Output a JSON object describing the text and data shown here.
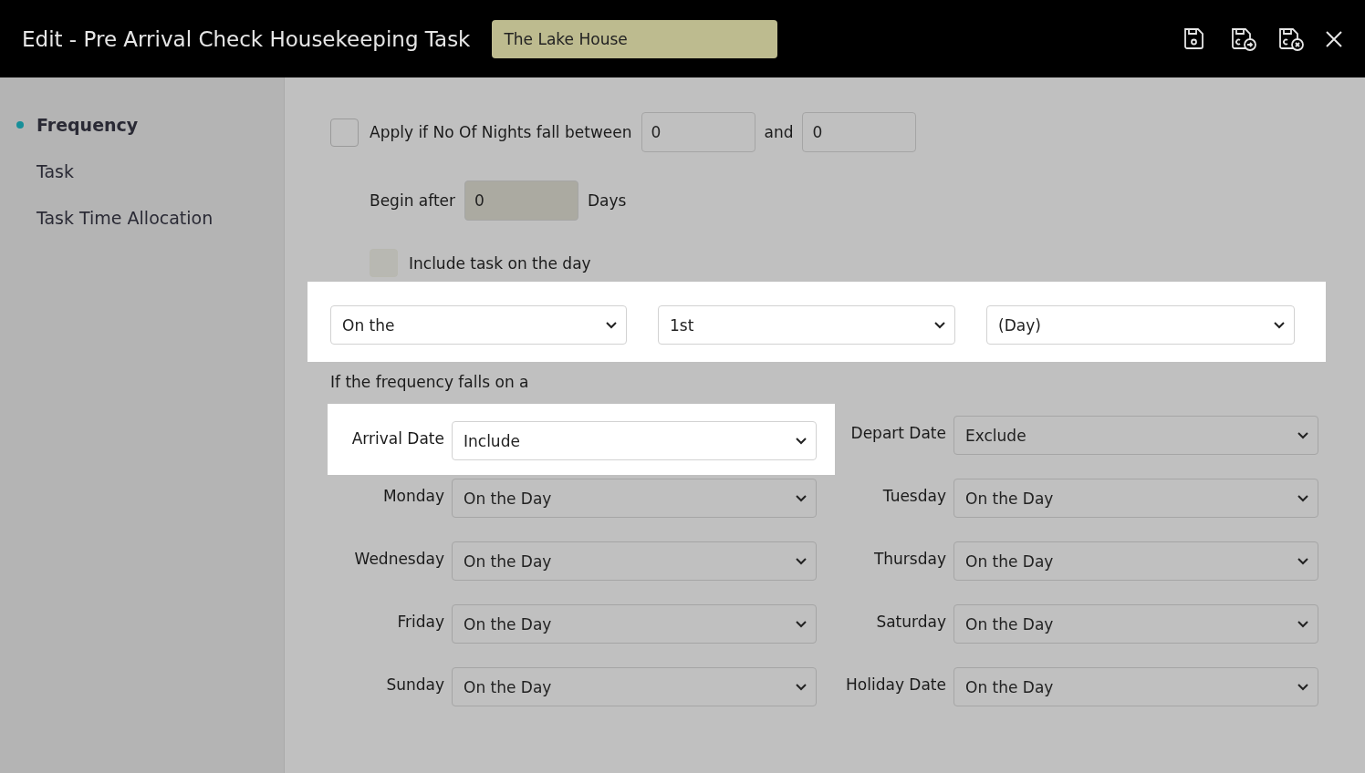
{
  "header": {
    "title": "Edit - Pre Arrival Check Housekeeping Task",
    "property": "The Lake House"
  },
  "sidebar": {
    "items": [
      {
        "label": "Frequency",
        "selected": true
      },
      {
        "label": "Task",
        "selected": false
      },
      {
        "label": "Task Time Allocation",
        "selected": false
      }
    ]
  },
  "nights": {
    "checked": false,
    "label": "Apply if No Of Nights fall between",
    "from": "0",
    "joiner": "and",
    "to": "0"
  },
  "begin_after": {
    "label": "Begin after",
    "value": "0",
    "unit": "Days",
    "disabled": true
  },
  "include_task": {
    "label": "Include task on the day",
    "checked": false,
    "disabled": true
  },
  "frequency": {
    "highlighted": true,
    "selects": [
      "On the",
      "1st",
      "(Day)"
    ]
  },
  "falls_on": {
    "heading": "If the frequency falls on a",
    "rows": [
      {
        "label": "Arrival Date",
        "value": "Include",
        "highlighted": true
      },
      {
        "label": "Depart Date",
        "value": "Exclude",
        "highlighted": false
      },
      {
        "label": "Monday",
        "value": "On the Day",
        "highlighted": false
      },
      {
        "label": "Tuesday",
        "value": "On the Day",
        "highlighted": false
      },
      {
        "label": "Wednesday",
        "value": "On the Day",
        "highlighted": false
      },
      {
        "label": "Thursday",
        "value": "On the Day",
        "highlighted": false
      },
      {
        "label": "Friday",
        "value": "On the Day",
        "highlighted": false
      },
      {
        "label": "Saturday",
        "value": "On the Day",
        "highlighted": false
      },
      {
        "label": "Sunday",
        "value": "On the Day",
        "highlighted": false
      },
      {
        "label": "Holiday Date",
        "value": "On the Day",
        "highlighted": false
      }
    ]
  }
}
